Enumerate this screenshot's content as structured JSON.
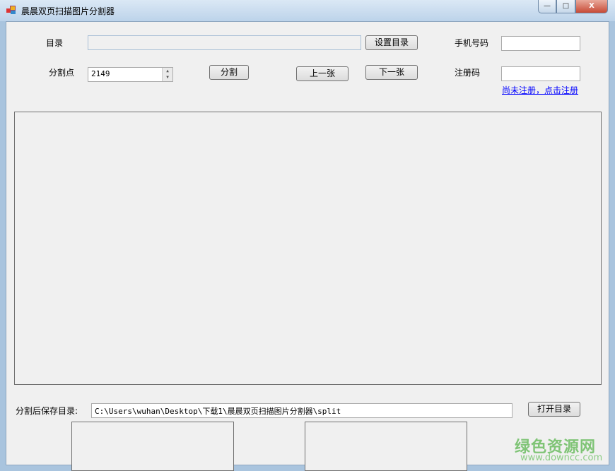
{
  "window": {
    "title": "晨晨双页扫描图片分割器",
    "minimize": "—",
    "maximize": "□",
    "close": "X"
  },
  "form": {
    "dir_label": "目录",
    "dir_value": "",
    "set_dir_button": "设置目录",
    "split_point_label": "分割点",
    "split_point_value": "2149",
    "split_button": "分割",
    "prev_button": "上一张",
    "next_button": "下一张",
    "phone_label": "手机号码",
    "phone_value": "",
    "reg_code_label": "注册码",
    "reg_code_value": "",
    "register_link": "尚未注册，点击注册",
    "save_dir_label": "分割后保存目录:",
    "save_dir_value": "C:\\Users\\wuhan\\Desktop\\下载1\\晨晨双页扫描图片分割器\\split",
    "open_dir_button": "打开目录"
  },
  "watermark": {
    "name": "绿色资源网",
    "url": "www.downcc.com"
  }
}
